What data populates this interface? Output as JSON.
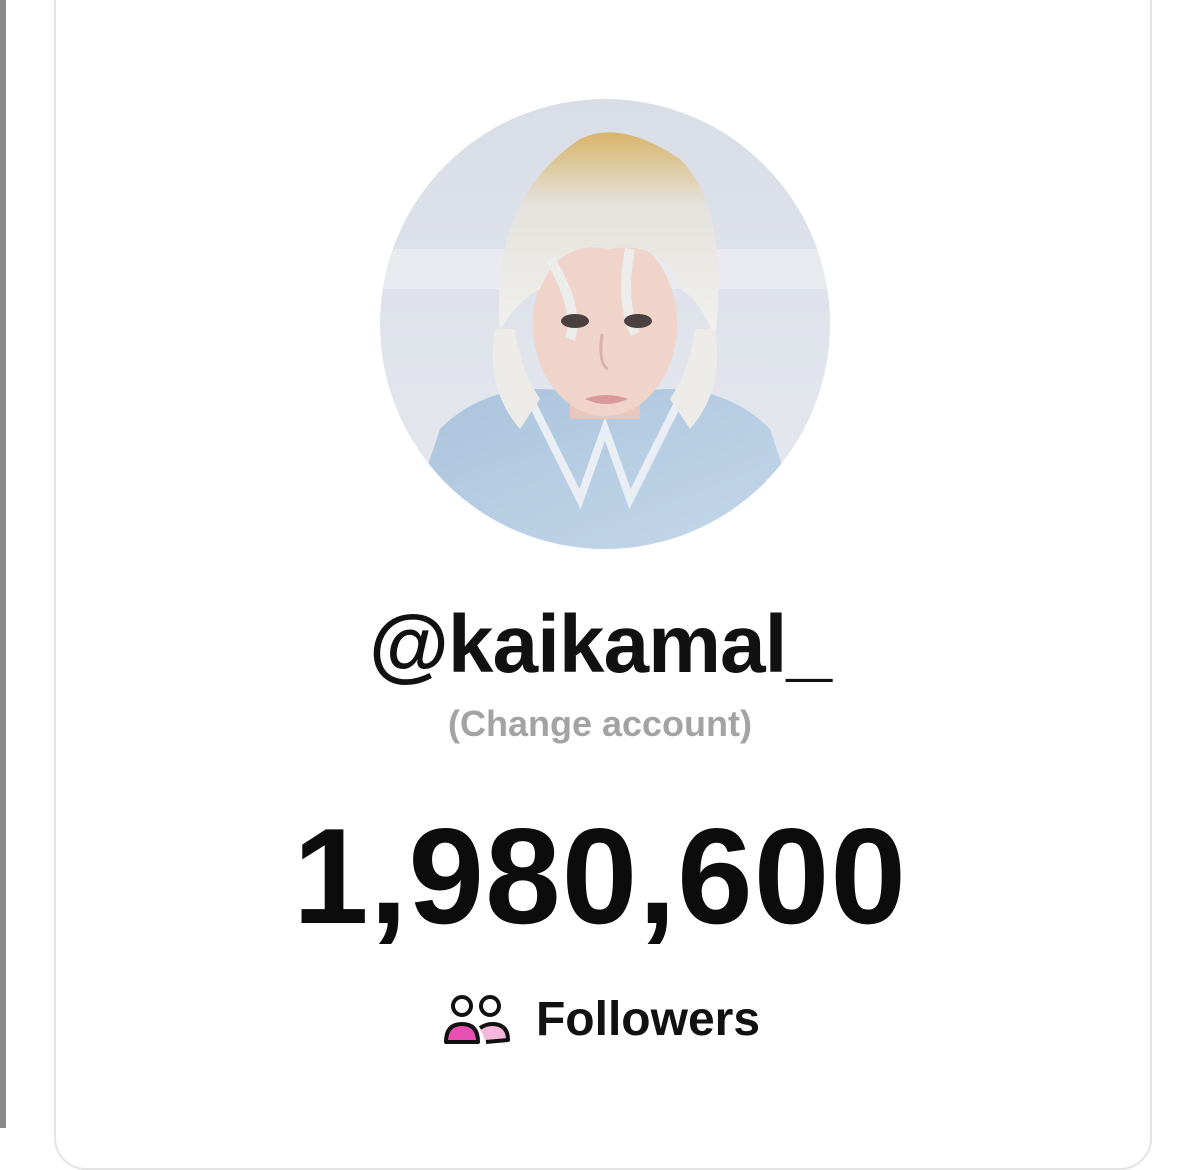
{
  "profile": {
    "username": "@kaikamal_",
    "change_account_label": "(Change account)",
    "follower_count": "1,980,600",
    "followers_label": "Followers"
  },
  "icons": {
    "avatar": "profile-photo",
    "followers": "people-icon"
  },
  "colors": {
    "accent": "#e84fb0",
    "muted_text": "#a3a3a3",
    "primary_text": "#111111"
  }
}
